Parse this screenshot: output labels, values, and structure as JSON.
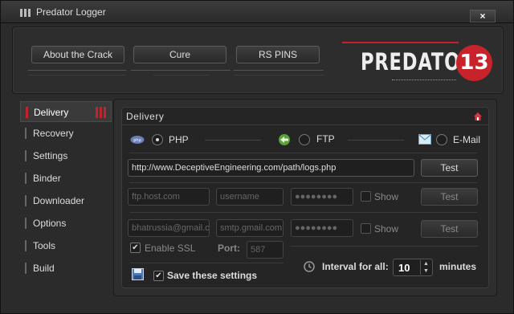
{
  "window": {
    "title": "Predator Logger",
    "close": "×"
  },
  "header": {
    "buttons": [
      "About the Crack",
      "Cure",
      "RS PINS"
    ],
    "logo_text": "PREDATOR",
    "logo_badge": "13"
  },
  "sidebar": {
    "items": [
      "Delivery",
      "Recovery",
      "Settings",
      "Binder",
      "Downloader",
      "Options",
      "Tools",
      "Build"
    ],
    "active": "Delivery"
  },
  "delivery": {
    "title": "Delivery",
    "methods": [
      {
        "label": "PHP",
        "selected": true
      },
      {
        "label": "FTP",
        "selected": false
      },
      {
        "label": "E-Mail",
        "selected": false
      }
    ],
    "php_url": "http://www.DeceptiveEngineering.com/path/logs.php",
    "php_test": "Test",
    "ftp": {
      "host_placeholder": "ftp.host.com",
      "user_placeholder": "username",
      "password": "●●●●●●●●",
      "show_label": "Show",
      "test": "Test"
    },
    "email": {
      "address_placeholder": "bhatrussia@gmail.c",
      "smtp_placeholder": "smtp.gmail.com",
      "password": "●●●●●●●●",
      "show_label": "Show",
      "test": "Test",
      "ssl_label": "Enable SSL",
      "port_label": "Port:",
      "port_value": "587"
    },
    "save_label": "Save these settings",
    "interval_label": "Interval for all:",
    "interval_value": "10",
    "interval_unit": "minutes"
  },
  "colors": {
    "accent": "#c0232b",
    "background": "#2b2b2b"
  }
}
